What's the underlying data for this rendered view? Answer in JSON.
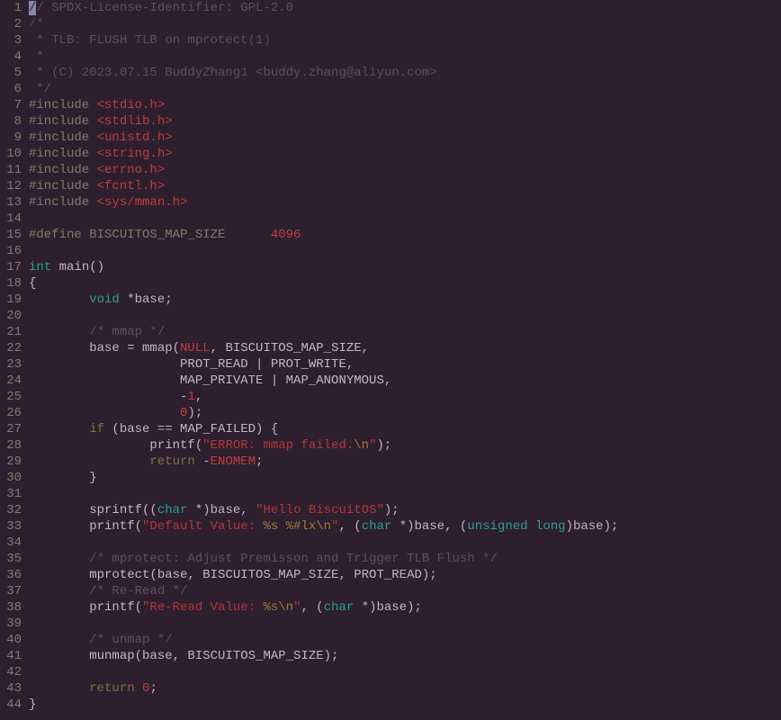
{
  "lines": [
    {
      "n": "1",
      "segs": [
        {
          "t": "/",
          "c": "cursor"
        },
        {
          "t": "/ SPDX-License-Identifier: GPL-2.0",
          "c": "comment"
        }
      ]
    },
    {
      "n": "2",
      "segs": [
        {
          "t": "/*",
          "c": "comment"
        }
      ]
    },
    {
      "n": "3",
      "segs": [
        {
          "t": " * TLB: FLUSH TLB on mprotect(1)",
          "c": "comment"
        }
      ]
    },
    {
      "n": "4",
      "segs": [
        {
          "t": " *",
          "c": "comment"
        }
      ]
    },
    {
      "n": "5",
      "segs": [
        {
          "t": " * (C) 2023.07.15 BuddyZhang1 <buddy.zhang@aliyun.com>",
          "c": "comment"
        }
      ]
    },
    {
      "n": "6",
      "segs": [
        {
          "t": " */",
          "c": "comment"
        }
      ]
    },
    {
      "n": "7",
      "segs": [
        {
          "t": "#include ",
          "c": "preproc"
        },
        {
          "t": "<stdio.h>",
          "c": "header"
        }
      ]
    },
    {
      "n": "8",
      "segs": [
        {
          "t": "#include ",
          "c": "preproc"
        },
        {
          "t": "<stdlib.h>",
          "c": "header"
        }
      ]
    },
    {
      "n": "9",
      "segs": [
        {
          "t": "#include ",
          "c": "preproc"
        },
        {
          "t": "<unistd.h>",
          "c": "header"
        }
      ]
    },
    {
      "n": "10",
      "segs": [
        {
          "t": "#include ",
          "c": "preproc"
        },
        {
          "t": "<string.h>",
          "c": "header"
        }
      ]
    },
    {
      "n": "11",
      "segs": [
        {
          "t": "#include ",
          "c": "preproc"
        },
        {
          "t": "<errno.h>",
          "c": "header"
        }
      ]
    },
    {
      "n": "12",
      "segs": [
        {
          "t": "#include ",
          "c": "preproc"
        },
        {
          "t": "<fcntl.h>",
          "c": "header"
        }
      ]
    },
    {
      "n": "13",
      "segs": [
        {
          "t": "#include ",
          "c": "preproc"
        },
        {
          "t": "<sys/mman.h>",
          "c": "header"
        }
      ]
    },
    {
      "n": "14",
      "segs": [
        {
          "t": " "
        }
      ]
    },
    {
      "n": "15",
      "segs": [
        {
          "t": "#define BISCUITOS_MAP_SIZE      ",
          "c": "preproc"
        },
        {
          "t": "4096",
          "c": "number"
        }
      ]
    },
    {
      "n": "16",
      "segs": [
        {
          "t": " "
        }
      ]
    },
    {
      "n": "17",
      "segs": [
        {
          "t": "int",
          "c": "keyword-type"
        },
        {
          "t": " main()"
        }
      ]
    },
    {
      "n": "18",
      "segs": [
        {
          "t": "{"
        }
      ]
    },
    {
      "n": "19",
      "segs": [
        {
          "t": "        "
        },
        {
          "t": "void",
          "c": "keyword-type"
        },
        {
          "t": " *base;"
        }
      ]
    },
    {
      "n": "20",
      "segs": [
        {
          "t": " "
        }
      ]
    },
    {
      "n": "21",
      "segs": [
        {
          "t": "        "
        },
        {
          "t": "/* mmap */",
          "c": "comment"
        }
      ]
    },
    {
      "n": "22",
      "segs": [
        {
          "t": "        base = mmap("
        },
        {
          "t": "NULL",
          "c": "const"
        },
        {
          "t": ", BISCUITOS_MAP_SIZE,"
        }
      ]
    },
    {
      "n": "23",
      "segs": [
        {
          "t": "                    PROT_READ | PROT_WRITE,"
        }
      ]
    },
    {
      "n": "24",
      "segs": [
        {
          "t": "                    MAP_PRIVATE | MAP_ANONYMOUS,"
        }
      ]
    },
    {
      "n": "25",
      "segs": [
        {
          "t": "                    -"
        },
        {
          "t": "1",
          "c": "number"
        },
        {
          "t": ","
        }
      ]
    },
    {
      "n": "26",
      "segs": [
        {
          "t": "                    "
        },
        {
          "t": "0",
          "c": "number"
        },
        {
          "t": ");"
        }
      ]
    },
    {
      "n": "27",
      "segs": [
        {
          "t": "        "
        },
        {
          "t": "if",
          "c": "keyword"
        },
        {
          "t": " (base == MAP_FAILED) {"
        }
      ]
    },
    {
      "n": "28",
      "segs": [
        {
          "t": "                printf("
        },
        {
          "t": "\"ERROR: mmap failed.",
          "c": "string"
        },
        {
          "t": "\\n",
          "c": "escape"
        },
        {
          "t": "\"",
          "c": "string"
        },
        {
          "t": ");"
        }
      ]
    },
    {
      "n": "29",
      "segs": [
        {
          "t": "                "
        },
        {
          "t": "return",
          "c": "keyword"
        },
        {
          "t": " -"
        },
        {
          "t": "ENOMEM",
          "c": "const"
        },
        {
          "t": ";"
        }
      ]
    },
    {
      "n": "30",
      "segs": [
        {
          "t": "        }"
        }
      ]
    },
    {
      "n": "31",
      "segs": [
        {
          "t": " "
        }
      ]
    },
    {
      "n": "32",
      "segs": [
        {
          "t": "        sprintf(("
        },
        {
          "t": "char",
          "c": "keyword-type"
        },
        {
          "t": " *)base, "
        },
        {
          "t": "\"Hello BiscuitOS\"",
          "c": "string"
        },
        {
          "t": ");"
        }
      ]
    },
    {
      "n": "33",
      "segs": [
        {
          "t": "        printf("
        },
        {
          "t": "\"Default Value: ",
          "c": "string"
        },
        {
          "t": "%s %#lx\\n",
          "c": "escape"
        },
        {
          "t": "\"",
          "c": "string"
        },
        {
          "t": ", ("
        },
        {
          "t": "char",
          "c": "keyword-type"
        },
        {
          "t": " *)base, ("
        },
        {
          "t": "unsigned",
          "c": "keyword-type"
        },
        {
          "t": " "
        },
        {
          "t": "long",
          "c": "keyword-type"
        },
        {
          "t": ")base);"
        }
      ]
    },
    {
      "n": "34",
      "segs": [
        {
          "t": " "
        }
      ]
    },
    {
      "n": "35",
      "segs": [
        {
          "t": "        "
        },
        {
          "t": "/* mprotect: Adjust Premisson and Trigger TLB Flush */",
          "c": "comment"
        }
      ]
    },
    {
      "n": "36",
      "segs": [
        {
          "t": "        mprotect(base, BISCUITOS_MAP_SIZE, PROT_READ);"
        }
      ]
    },
    {
      "n": "37",
      "segs": [
        {
          "t": "        "
        },
        {
          "t": "/* Re-Read */",
          "c": "comment"
        }
      ]
    },
    {
      "n": "38",
      "segs": [
        {
          "t": "        printf("
        },
        {
          "t": "\"Re-Read Value: ",
          "c": "string"
        },
        {
          "t": "%s\\n",
          "c": "escape"
        },
        {
          "t": "\"",
          "c": "string"
        },
        {
          "t": ", ("
        },
        {
          "t": "char",
          "c": "keyword-type"
        },
        {
          "t": " *)base);"
        }
      ]
    },
    {
      "n": "39",
      "segs": [
        {
          "t": " "
        }
      ]
    },
    {
      "n": "40",
      "segs": [
        {
          "t": "        "
        },
        {
          "t": "/* unmap */",
          "c": "comment"
        }
      ]
    },
    {
      "n": "41",
      "segs": [
        {
          "t": "        munmap(base, BISCUITOS_MAP_SIZE);"
        }
      ]
    },
    {
      "n": "42",
      "segs": [
        {
          "t": " "
        }
      ]
    },
    {
      "n": "43",
      "segs": [
        {
          "t": "        "
        },
        {
          "t": "return",
          "c": "keyword"
        },
        {
          "t": " "
        },
        {
          "t": "0",
          "c": "number"
        },
        {
          "t": ";"
        }
      ]
    },
    {
      "n": "44",
      "segs": [
        {
          "t": "}"
        }
      ]
    }
  ]
}
